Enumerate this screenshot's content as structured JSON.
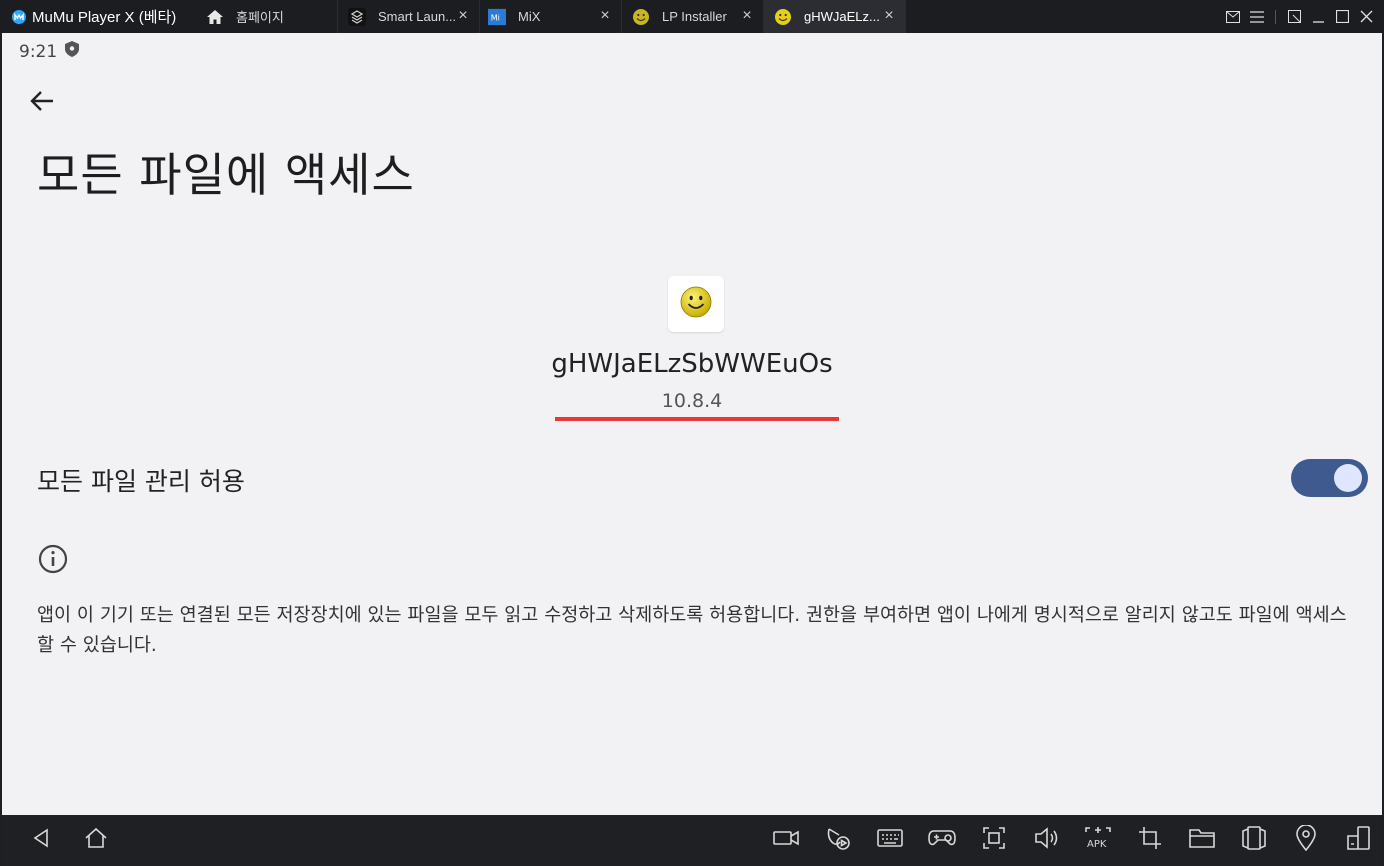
{
  "titlebar": {
    "app_title": "MuMu Player X (베타)",
    "tabs": [
      {
        "label": "홈페이지",
        "icon": "home-icon"
      },
      {
        "label": "Smart Laun...",
        "icon": "smart-launcher-icon"
      },
      {
        "label": "MiX",
        "icon": "mix-icon"
      },
      {
        "label": "LP Installer",
        "icon": "smiley-icon"
      },
      {
        "label": "gHWJaELz...",
        "icon": "smiley-icon"
      }
    ]
  },
  "status_bar": {
    "time": "9:21"
  },
  "page": {
    "title": "모든 파일에 액세스",
    "app_name": "gHWJaELzSbWWEuOs",
    "app_version": "10.8.4",
    "toggle_label": "모든 파일 관리 허용",
    "toggle_on": true,
    "description": "앱이 이 기기 또는 연결된 모든 저장장치에 있는 파일을 모두 읽고 수정하고 삭제하도록 허용합니다. 권한을 부여하면 앱이 나에게 명시적으로 알리지 않고도 파일에 액세스할 수 있습니다."
  },
  "colors": {
    "accent_toggle": "#3e5a8e",
    "highlight_line": "#e53935",
    "background": "#f2f2f5"
  }
}
